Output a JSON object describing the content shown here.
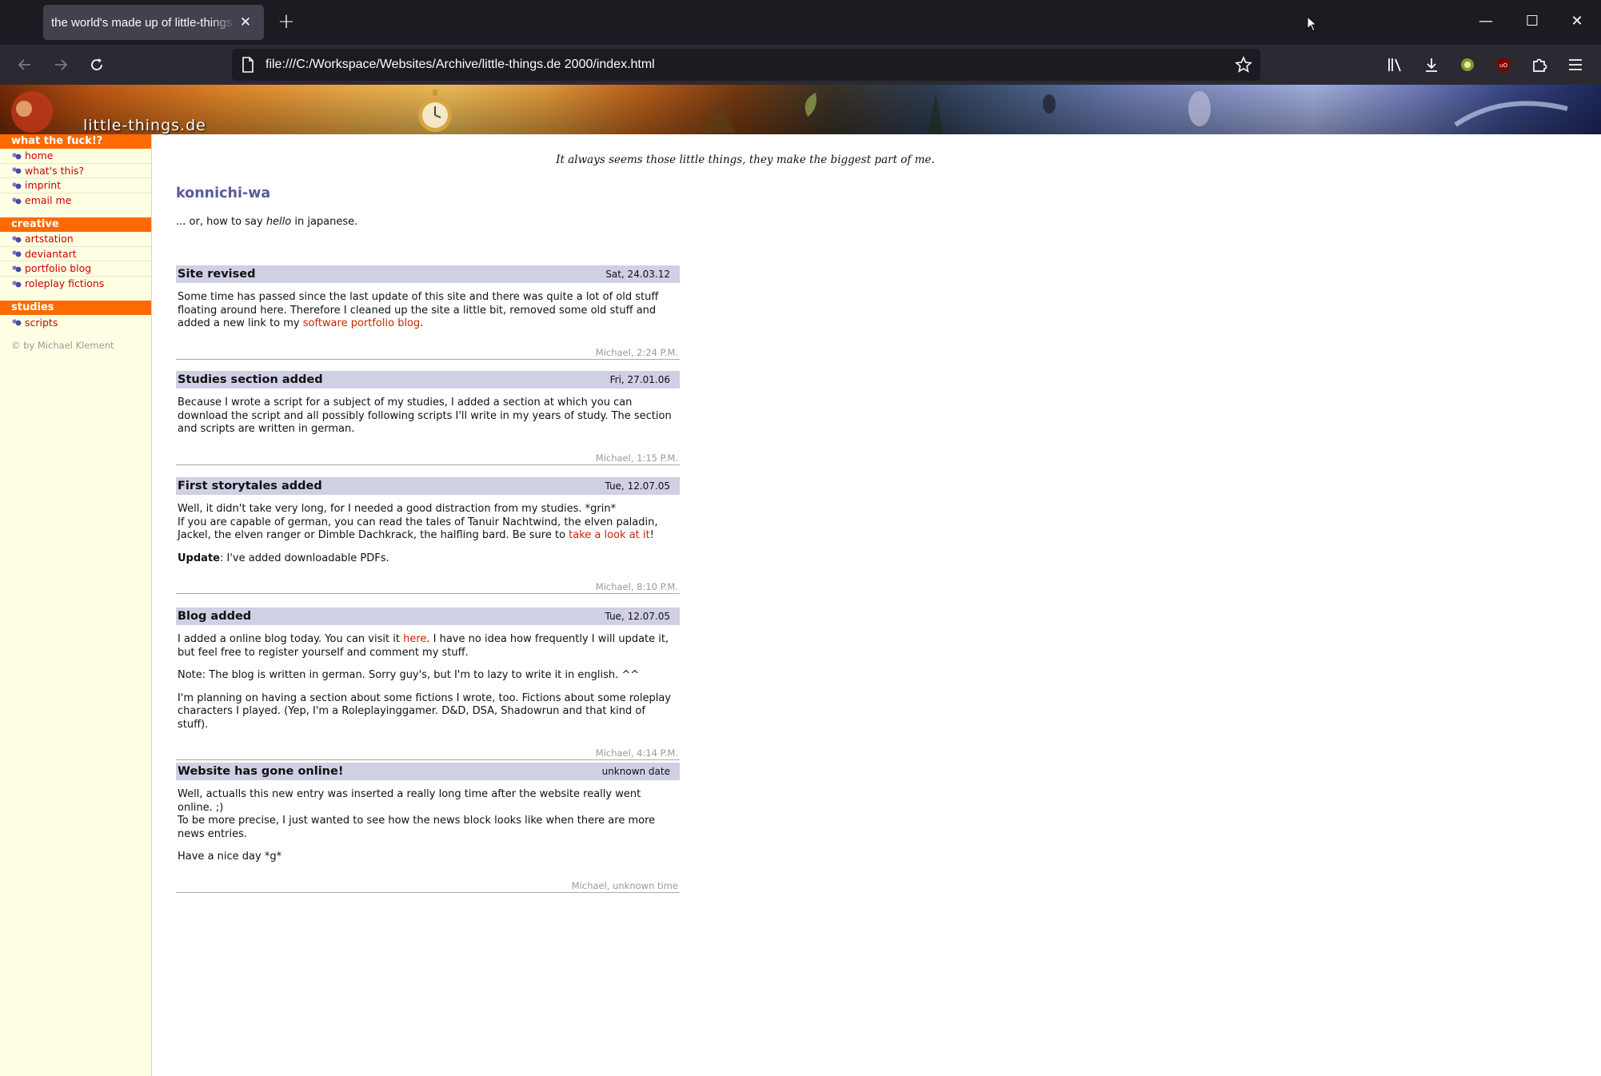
{
  "browser": {
    "tab_title": "the world's made up of little-things.de",
    "url": "file:///C:/Workspace/Websites/Archive/little-things.de 2000/index.html"
  },
  "banner": {
    "logo_text": "little-things.de"
  },
  "sidebar": {
    "sections": [
      {
        "title": "what the fuck!?",
        "items": [
          "home",
          "what's this?",
          "imprint",
          "email me"
        ]
      },
      {
        "title": "creative",
        "items": [
          "artstation",
          "deviantart",
          "portfolio blog",
          "roleplay fictions"
        ]
      },
      {
        "title": "studies",
        "items": [
          "scripts"
        ]
      }
    ],
    "copyright": "© by Michael Klement"
  },
  "main": {
    "slogan": "It always seems those little things, they make the biggest part of me.",
    "greeting_title": "konnichi-wa",
    "greeting_pre": "... or, how to say ",
    "greeting_em": "hello",
    "greeting_post": " in japanese."
  },
  "news": [
    {
      "title": "Site revised",
      "date": "Sat, 24.03.12",
      "p1_a": "Some time has passed since the last update of this site and there was quite a lot of old stuff floating around here. Therefore I cleaned up the site a little bit, removed some old stuff and added a new link to my ",
      "p1_link": "software portfolio blog",
      "p1_b": ".",
      "footer": "Michael, 2:24 P.M."
    },
    {
      "title": "Studies section added",
      "date": "Fri, 27.01.06",
      "p1": "Because I wrote a script for a subject of my studies, I added a section at which you can download the script and all possibly following scripts I'll write in my years of study. The section and scripts are written in german.",
      "footer": "Michael, 1:15 P.M."
    },
    {
      "title": "First storytales added",
      "date": "Tue, 12.07.05",
      "p1_line1": "Well, it didn't take very long, for I needed a good distraction from my studies. *grin*",
      "p1_a": "If you are capable of german, you can read the tales of Tanuir Nachtwind, the elven paladin, Jackel, the elven ranger or Dimble Dachkrack, the halfling bard. Be sure to ",
      "p1_link": "take a look at it",
      "p1_b": "!",
      "p2_bold": "Update",
      "p2_text": ": I've added downloadable PDFs.",
      "footer": "Michael, 8:10 P.M."
    },
    {
      "title": "Blog added",
      "date": "Tue, 12.07.05",
      "p1_a": "I added a online blog today. You can visit it ",
      "p1_link": "here",
      "p1_b": ". I have no idea how frequently I will update it, but feel free to register yourself and comment my stuff.",
      "p2": "Note: The blog is written in german. Sorry guy's, but I'm to lazy to write it in english. ^^",
      "p3": "I'm planning on having a section about some fictions I wrote, too. Fictions about some roleplay characters I played. (Yep, I'm a Roleplayinggamer. D&D, DSA, Shadowrun and that kind of stuff).",
      "footer": "Michael, 4:14 P.M."
    },
    {
      "title": "Website has gone online!",
      "date": "unknown date",
      "p1_line1": "Well, actualls this new entry was inserted a really long time after the website really went online. ;)",
      "p1_line2": "To be more precise, I just wanted to see how the news block looks like when there are more news entries.",
      "p2": "Have a nice day *g*",
      "footer": "Michael, unknown time"
    }
  ],
  "colors": {
    "accent": "#ff6a00",
    "link": "#cc0000",
    "sidebar_bg": "#ffffe3",
    "news_head": "#cfd0e4",
    "heading": "#5a5aa0"
  }
}
